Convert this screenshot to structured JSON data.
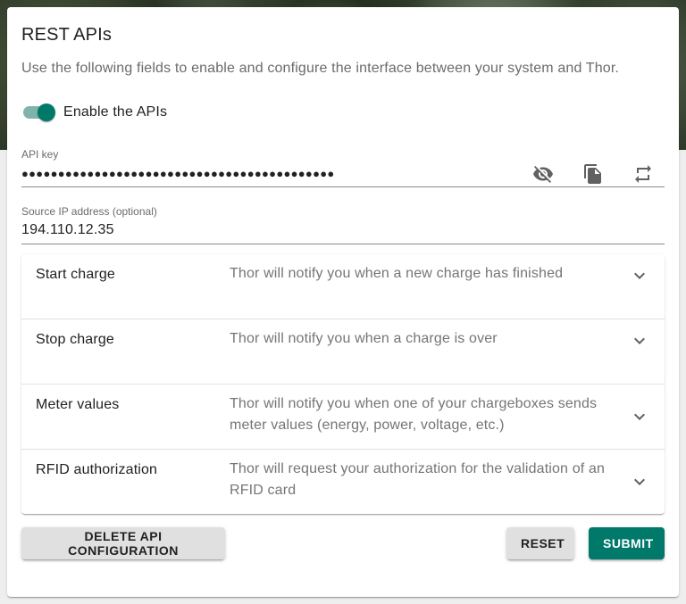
{
  "card": {
    "title": "REST APIs",
    "description": "Use the following fields to enable and configure the interface between your system and Thor."
  },
  "toggle": {
    "label": "Enable the APIs",
    "checked": true,
    "color": "#00796b"
  },
  "api_key": {
    "label": "API key",
    "value": "●●●●●●●●●●●●●●●●●●●●●●●●●●●●●●●●●●●●●●●●●●●",
    "icons": [
      "visibility-off-icon",
      "copy-icon",
      "regenerate-icon"
    ]
  },
  "source_ip": {
    "label": "Source IP address (optional)",
    "value": "194.110.12.35"
  },
  "events": [
    {
      "title": "Start charge",
      "description": "Thor will notify you when a new charge has finished"
    },
    {
      "title": "Stop charge",
      "description": "Thor will notify you when a charge is over"
    },
    {
      "title": "Meter values",
      "description": "Thor will notify you when one of your chargeboxes sends meter values (energy, power, voltage, etc.)"
    },
    {
      "title": "RFID authorization",
      "description": "Thor will request your authorization for the validation of an RFID card"
    }
  ],
  "actions": {
    "delete_label": "DELETE API CONFIGURATION",
    "reset_label": "RESET",
    "submit_label": "SUBMIT"
  },
  "colors": {
    "primary": "#00796b",
    "primary_light": "#80b4aa",
    "button_grey": "#e0e0e0"
  }
}
